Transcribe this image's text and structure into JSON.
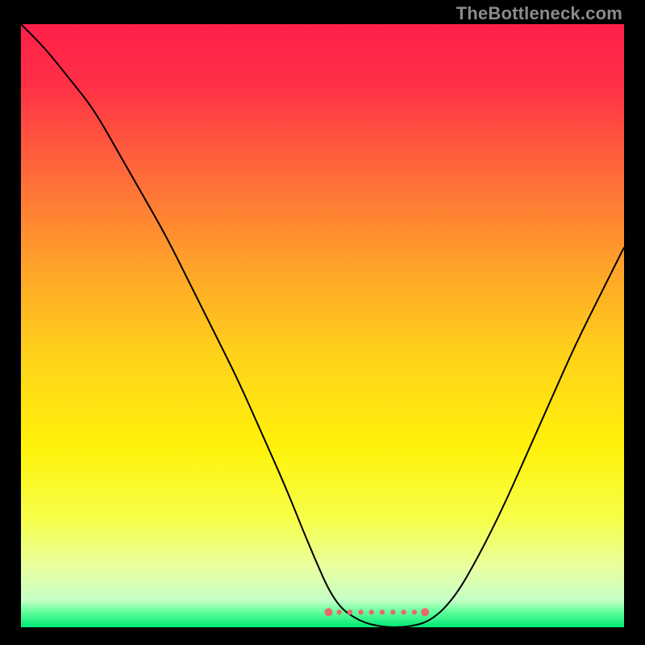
{
  "watermark": "TheBottleneck.com",
  "chart_data": {
    "type": "line",
    "title": "",
    "xlabel": "",
    "ylabel": "",
    "xlim": [
      0,
      100
    ],
    "ylim": [
      0,
      100
    ],
    "grid": false,
    "legend": false,
    "background": {
      "kind": "vertical-gradient",
      "stops": [
        {
          "pos": 0.0,
          "color": "#ff1f4a"
        },
        {
          "pos": 0.1,
          "color": "#ff3046"
        },
        {
          "pos": 0.25,
          "color": "#ff6b3a"
        },
        {
          "pos": 0.4,
          "color": "#ffa229"
        },
        {
          "pos": 0.55,
          "color": "#ffd21a"
        },
        {
          "pos": 0.7,
          "color": "#fff20a"
        },
        {
          "pos": 0.82,
          "color": "#f6ff49"
        },
        {
          "pos": 0.9,
          "color": "#e9ffa0"
        },
        {
          "pos": 0.955,
          "color": "#c6ffc6"
        },
        {
          "pos": 0.975,
          "color": "#60ff9a"
        },
        {
          "pos": 1.0,
          "color": "#00e876"
        }
      ]
    },
    "series": [
      {
        "name": "bottleneck-curve",
        "stroke": "#000000",
        "stroke_width": 2,
        "x": [
          0,
          4,
          8,
          12,
          16,
          20,
          24,
          28,
          32,
          36,
          40,
          44,
          48,
          52,
          56,
          60,
          64,
          68,
          72,
          76,
          80,
          84,
          88,
          92,
          96,
          100
        ],
        "y": [
          100,
          96,
          91,
          86,
          79,
          72,
          65,
          57,
          49,
          41,
          32,
          23,
          13,
          4,
          1,
          0,
          0,
          1,
          5,
          12,
          20,
          29,
          38,
          47,
          55,
          63
        ]
      }
    ],
    "annotations": [
      {
        "name": "minimum-highlight",
        "kind": "dotted-segment",
        "color": "#e86a6a",
        "y": 2.5,
        "x_start": 51,
        "x_end": 67,
        "marker_radius": 4
      }
    ]
  }
}
